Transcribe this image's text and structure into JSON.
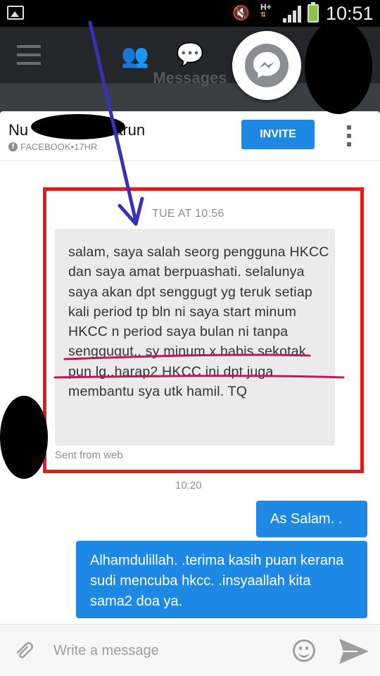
{
  "status_bar": {
    "network_label": "H+",
    "network_arrows": "⇅",
    "time": "10:51",
    "mute_icon": "vibrate-mute-icon",
    "gallery_icon": "gallery-icon"
  },
  "app_bar": {
    "title": "Messages",
    "menu_icon": "menu-icon",
    "friends_icon": "friends-icon",
    "chat_icon": "chat-icon",
    "messenger_icon": "messenger-icon"
  },
  "chat": {
    "contact": {
      "name_start": "Nu",
      "name_end": "arun",
      "source": "FACEBOOK",
      "separator": " • ",
      "time": "17HR"
    },
    "invite_label": "INVITE",
    "date_stamp": "TUE AT 10:56",
    "incoming_message": "salam, saya salah seorg pengguna HKCC dan saya amat berpuashati. selalunya saya akan dpt senggugt yg teruk setiap kali period tp bln ni saya start minum HKCC n period saya bulan ni tanpa senggugut.. sy minum x habis sekotak pun lg..harap2 HKCC ini dpt juga membantu sya utk hamil. TQ",
    "sent_from": "Sent from web",
    "time_stamp": "10:20",
    "outgoing_messages": [
      "As Salam. .",
      "Alhamdulillah. .terima kasih puan kerana sudi mencuba hkcc. .insyaallah kita sama2 doa ya."
    ]
  },
  "composer": {
    "placeholder": "Write a message",
    "value": "",
    "attach_icon": "paperclip-icon",
    "emoji_icon": "emoji-icon",
    "send_icon": "send-icon"
  },
  "colors": {
    "accent_blue": "#1e88e5",
    "annotation_red": "#e21b1b",
    "annotation_arrow": "#3a2fb8",
    "underline": "#c2185b"
  }
}
